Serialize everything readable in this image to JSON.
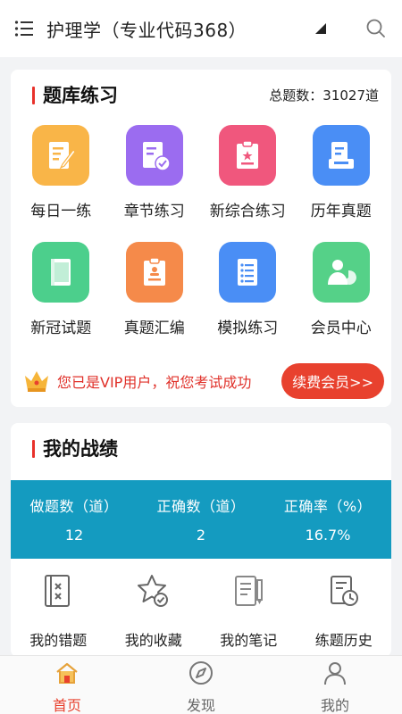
{
  "header": {
    "title": "护理学（专业代码368）",
    "icons": [
      "menu-icon",
      "caret-down-icon",
      "search-icon"
    ]
  },
  "practice": {
    "section_title": "题库练习",
    "total_label": "总题数：31027道",
    "items": [
      {
        "label": "每日一练",
        "icon": "daily-practice-icon",
        "color": "#f9b548"
      },
      {
        "label": "章节练习",
        "icon": "chapter-practice-icon",
        "color": "#9b6cf0"
      },
      {
        "label": "新综合练习",
        "icon": "comprehensive-practice-icon",
        "color": "#f0577d"
      },
      {
        "label": "历年真题",
        "icon": "past-exams-icon",
        "color": "#4a8ef5"
      },
      {
        "label": "新冠试题",
        "icon": "covid-questions-icon",
        "color": "#4ccf8c"
      },
      {
        "label": "真题汇编",
        "icon": "exam-compilation-icon",
        "color": "#f58a4a"
      },
      {
        "label": "模拟练习",
        "icon": "mock-practice-icon",
        "color": "#4a8ef5"
      },
      {
        "label": "会员中心",
        "icon": "member-center-icon",
        "color": "#55d188"
      }
    ]
  },
  "vip": {
    "text": "您已是VIP用户，祝您考试成功",
    "button_label": "续费会员>>",
    "icon": "crown-icon"
  },
  "record": {
    "section_title": "我的战绩",
    "stats": [
      {
        "label": "做题数（道）",
        "value": "12"
      },
      {
        "label": "正确数（道）",
        "value": "2"
      },
      {
        "label": "正确率（%）",
        "value": "16.7%"
      }
    ],
    "tools": [
      {
        "label": "我的错题",
        "icon": "wrong-questions-icon"
      },
      {
        "label": "我的收藏",
        "icon": "favorites-icon"
      },
      {
        "label": "我的笔记",
        "icon": "notes-icon"
      },
      {
        "label": "练题历史",
        "icon": "history-icon"
      }
    ]
  },
  "nav": {
    "items": [
      {
        "label": "首页",
        "icon": "home-icon",
        "active": true
      },
      {
        "label": "发现",
        "icon": "compass-icon",
        "active": false
      },
      {
        "label": "我的",
        "icon": "user-icon",
        "active": false
      }
    ]
  },
  "colors": {
    "accent_red": "#e8412e",
    "stats_bg": "#149bc0",
    "background": "#f2f3f5"
  }
}
